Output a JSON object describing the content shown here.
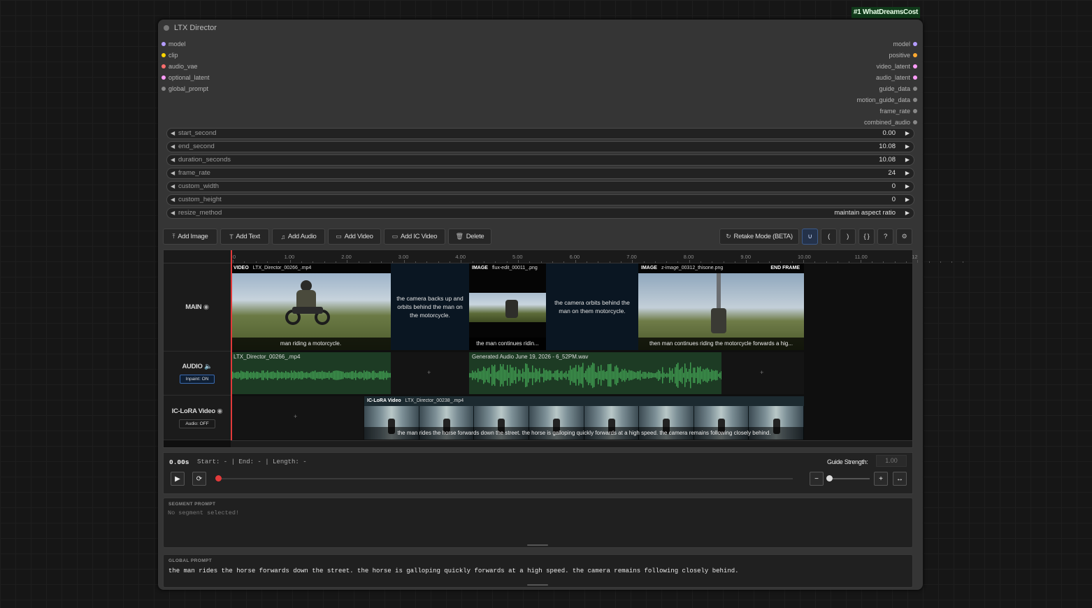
{
  "badge": "#1 WhatDreamsCost",
  "node": {
    "title": "LTX Director",
    "inputs": [
      {
        "label": "model",
        "color": "#b49cff"
      },
      {
        "label": "clip",
        "color": "#ffd500"
      },
      {
        "label": "audio_vae",
        "color": "#ff6e6e"
      },
      {
        "label": "optional_latent",
        "color": "#ff9cf9"
      },
      {
        "label": "global_prompt",
        "color": "#888888"
      }
    ],
    "outputs": [
      {
        "label": "model",
        "color": "#b49cff"
      },
      {
        "label": "positive",
        "color": "#ffa931"
      },
      {
        "label": "video_latent",
        "color": "#ff9cf9"
      },
      {
        "label": "audio_latent",
        "color": "#ff9cf9"
      },
      {
        "label": "guide_data",
        "color": "#888888"
      },
      {
        "label": "motion_guide_data",
        "color": "#888888"
      },
      {
        "label": "frame_rate",
        "color": "#888888"
      },
      {
        "label": "combined_audio",
        "color": "#888888"
      }
    ],
    "widgets": [
      {
        "label": "start_second",
        "value": "0.00"
      },
      {
        "label": "end_second",
        "value": "10.08"
      },
      {
        "label": "duration_seconds",
        "value": "10.08"
      },
      {
        "label": "frame_rate",
        "value": "24"
      },
      {
        "label": "custom_width",
        "value": "0"
      },
      {
        "label": "custom_height",
        "value": "0"
      },
      {
        "label": "resize_method",
        "value": "maintain aspect ratio"
      }
    ]
  },
  "toolbar": {
    "add_image": "Add Image",
    "add_text": "Add Text",
    "add_audio": "Add Audio",
    "add_video": "Add Video",
    "add_ic_video": "Add IC Video",
    "delete": "Delete",
    "retake": "Retake Mode (BETA)",
    "bracket_open": "(",
    "bracket_close": ")",
    "braces": "{ }",
    "help": "?"
  },
  "ruler_ticks": [
    "0",
    "1.00",
    "2.00",
    "3.00",
    "4.00",
    "5.00",
    "6.00",
    "7.00",
    "8.00",
    "9.00",
    "10.00",
    "11.00",
    "12"
  ],
  "tracks": {
    "main": {
      "name": "MAIN"
    },
    "audio": {
      "name": "AUDIO",
      "pill": "Inpaint: ON"
    },
    "ic": {
      "name": "IC-LoRA Video",
      "pill": "Audio: OFF"
    }
  },
  "clips": {
    "video1": {
      "type": "VIDEO",
      "file": "LTX_Director_00266_.mp4",
      "caption": "man riding a motorcycle."
    },
    "text1": {
      "text": "the camera backs up and orbits behind the man on the motorcycle."
    },
    "image1": {
      "type": "IMAGE",
      "file": "flux-edit_00011_.png",
      "caption": "the man continues ridin..."
    },
    "text2": {
      "text": "the camera orbits behind the man on them motorcycle."
    },
    "image2": {
      "type": "IMAGE",
      "file": "z-image_00312_thisone.png",
      "end": "END FRAME",
      "caption": "then man continues riding the motorcycle forwards a hig..."
    },
    "audio1": {
      "file": "LTX_Director_00266_.mp4"
    },
    "audio2": {
      "file": "Generated Audio June 19, 2026 - 6_52PM.wav"
    },
    "ic1": {
      "type": "IC-LoRA Video",
      "file": "LTX_Director_00238_.mp4",
      "caption": "the man rides the horse forwards down the street. the horse is galloping quickly forwards at a high speed. the camera remains following closely behind."
    }
  },
  "transport": {
    "time": "0.00s",
    "info": "Start: - | End: - | Length: -",
    "guide_label": "Guide Strength:",
    "guide_value": "1.00",
    "playhead": 0.0,
    "guide_slider": 0.0
  },
  "segment_prompt": {
    "title": "SEGMENT PROMPT",
    "placeholder": "No segment selected!"
  },
  "global_prompt": {
    "title": "GLOBAL PROMPT",
    "text": "the man rides the horse forwards down the street. the horse is galloping quickly forwards at a high speed. the camera remains following closely behind."
  }
}
